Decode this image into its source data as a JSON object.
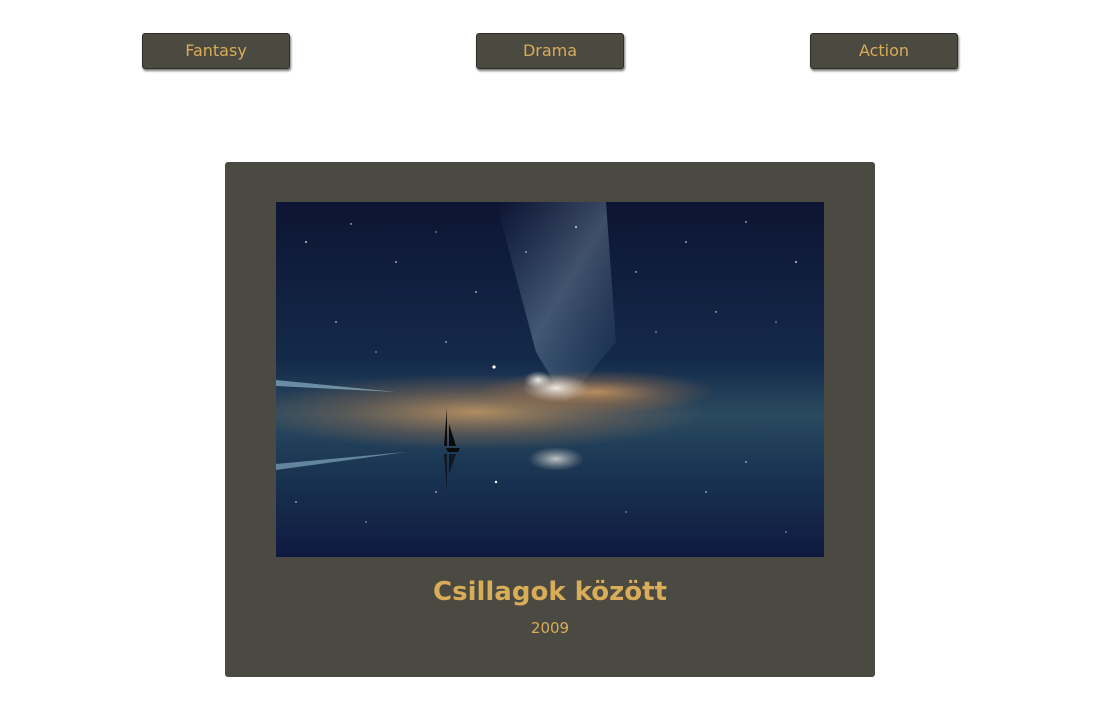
{
  "genres": [
    {
      "label": "Fantasy"
    },
    {
      "label": "Drama"
    },
    {
      "label": "Action"
    }
  ],
  "movie": {
    "title": "Csillagok között",
    "year": "2009",
    "poster_icon": "night-sea-sailboat-image"
  },
  "colors": {
    "accent_text": "#d9ac58",
    "button_bg": "#4b4a41",
    "card_bg": "#4a4a42",
    "page_bg": "#ffffff"
  }
}
